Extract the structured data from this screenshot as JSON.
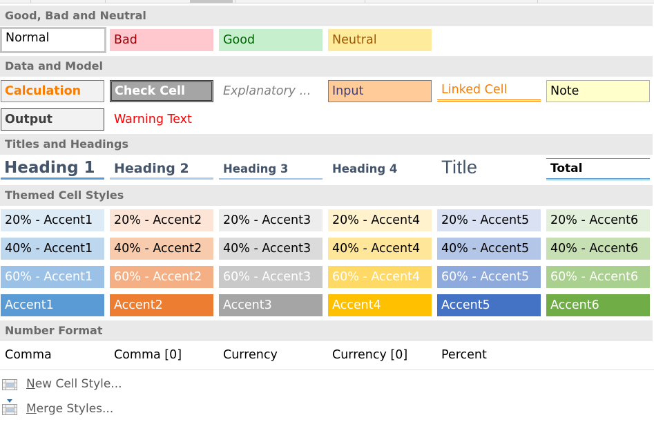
{
  "sections": {
    "good_bad_neutral": "Good, Bad and Neutral",
    "data_model": "Data and Model",
    "titles_headings": "Titles and Headings",
    "themed": "Themed Cell Styles",
    "number_format": "Number Format"
  },
  "good_bad_neutral": {
    "normal": "Normal",
    "bad": "Bad",
    "good": "Good",
    "neutral": "Neutral"
  },
  "data_model": {
    "calculation": "Calculation",
    "check_cell": "Check Cell",
    "explanatory": "Explanatory ...",
    "input": "Input",
    "linked_cell": "Linked Cell",
    "note": "Note",
    "output": "Output",
    "warning_text": "Warning Text"
  },
  "titles_headings": {
    "heading1": "Heading 1",
    "heading2": "Heading 2",
    "heading3": "Heading 3",
    "heading4": "Heading 4",
    "title": "Title",
    "total": "Total"
  },
  "themed": {
    "rows": [
      {
        "labels": [
          "20% - Accent1",
          "20% - Accent2",
          "20% - Accent3",
          "20% - Accent4",
          "20% - Accent5",
          "20% - Accent6"
        ],
        "colors": [
          "#ddebf7",
          "#fce4d6",
          "#ededed",
          "#fff2cc",
          "#d9e1f2",
          "#e2efda"
        ]
      },
      {
        "labels": [
          "40% - Accent1",
          "40% - Accent2",
          "40% - Accent3",
          "40% - Accent4",
          "40% - Accent5",
          "40% - Accent6"
        ],
        "colors": [
          "#bdd7ee",
          "#f8cbad",
          "#dbdbdb",
          "#ffe699",
          "#b4c6e7",
          "#c6e0b4"
        ]
      },
      {
        "labels": [
          "60% - Accent1",
          "60% - Accent2",
          "60% - Accent3",
          "60% - Accent4",
          "60% - Accent5",
          "60% - Accent6"
        ],
        "colors": [
          "#9bc2e6",
          "#f4b084",
          "#c9c9c9",
          "#ffd966",
          "#8ea9db",
          "#a9d08e"
        ]
      },
      {
        "labels": [
          "Accent1",
          "Accent2",
          "Accent3",
          "Accent4",
          "Accent5",
          "Accent6"
        ],
        "colors": [
          "#5b9bd5",
          "#ed7d31",
          "#a5a5a5",
          "#ffc000",
          "#4472c4",
          "#70ad47"
        ]
      }
    ]
  },
  "number_format": {
    "items": [
      "Comma",
      "Comma [0]",
      "Currency",
      "Currency [0]",
      "Percent"
    ]
  },
  "menu": {
    "new_cell_style": {
      "accel": "N",
      "rest": "ew Cell Style...",
      "icon": "new-cell-style-icon"
    },
    "merge_styles": {
      "accel": "M",
      "rest": "erge Styles...",
      "icon": "merge-styles-icon"
    }
  }
}
